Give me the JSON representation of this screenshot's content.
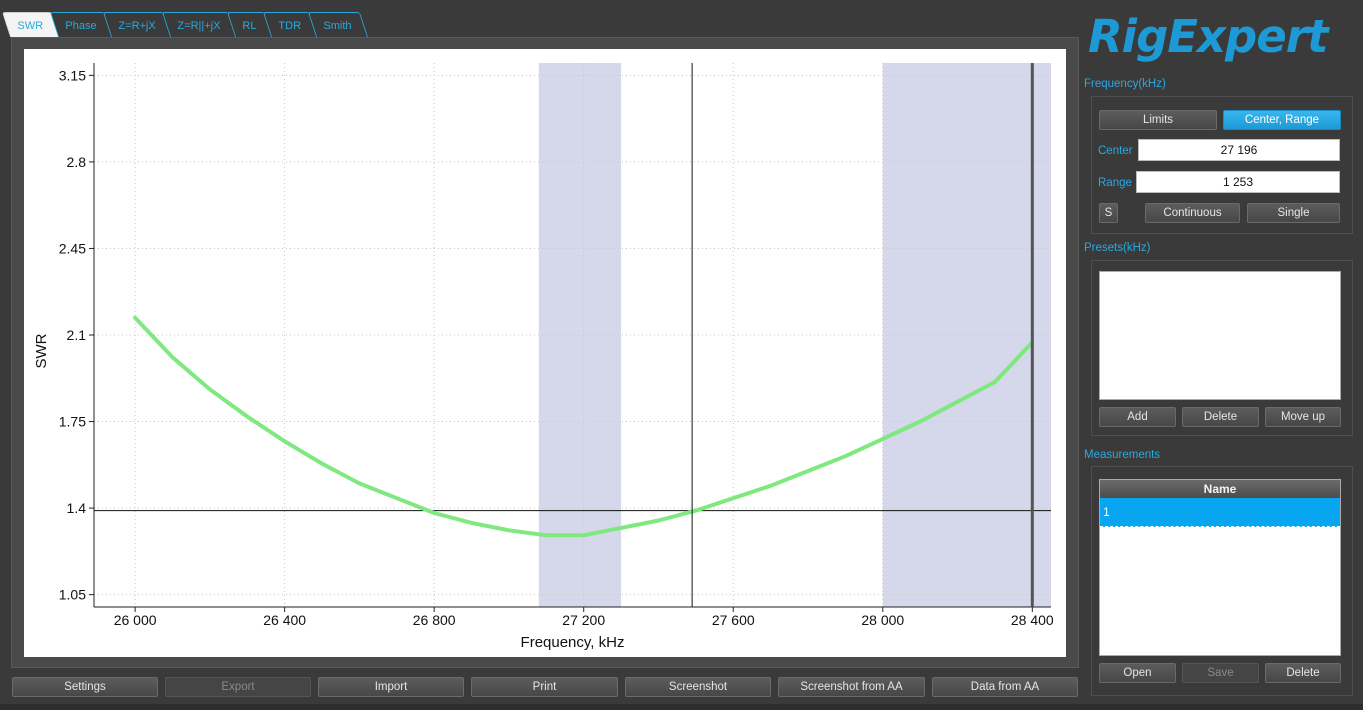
{
  "tabs": [
    "SWR",
    "Phase",
    "Z=R+jX",
    "Z=R||+jX",
    "RL",
    "TDR",
    "Smith"
  ],
  "active_tab": "SWR",
  "logo_text": "RigExpert",
  "frequency": {
    "title": "Frequency(kHz)",
    "limits_label": "Limits",
    "center_range_label": "Center, Range",
    "center_label": "Center",
    "center_value": "27 196",
    "range_label": "Range",
    "range_value": "1 253",
    "s_label": "S",
    "continuous_label": "Continuous",
    "single_label": "Single"
  },
  "presets": {
    "title": "Presets(kHz)",
    "add_label": "Add",
    "delete_label": "Delete",
    "move_up_label": "Move up"
  },
  "measurements": {
    "title": "Measurements",
    "column_name": "Name",
    "rows": [
      "1"
    ],
    "open_label": "Open",
    "save_label": "Save",
    "delete_label": "Delete"
  },
  "bottom_buttons": {
    "settings": "Settings",
    "export": "Export",
    "import": "Import",
    "print": "Print",
    "screenshot": "Screenshot",
    "screenshot_from_aa": "Screenshot from AA",
    "data_from_aa": "Data from AA"
  },
  "colors": {
    "accent": "#29a9e0",
    "curve": "#7fe87f",
    "band": "#d5d7ea",
    "selection": "#08a6f0"
  },
  "chart_data": {
    "type": "line",
    "xlabel": "Frequency, kHz",
    "ylabel": "SWR",
    "xlim": [
      25890,
      28450
    ],
    "ylim": [
      1.0,
      3.2
    ],
    "x_ticks": [
      26000,
      26400,
      26800,
      27200,
      27600,
      28000,
      28400
    ],
    "x_tick_labels": [
      "26 000",
      "26 400",
      "26 800",
      "27 200",
      "27 600",
      "28 000",
      "28 400"
    ],
    "y_ticks": [
      1.05,
      1.4,
      1.75,
      2.1,
      2.45,
      2.8,
      3.15
    ],
    "y_tick_labels": [
      "1.05",
      "1.4",
      "1.75",
      "2.1",
      "2.45",
      "2.8",
      "3.15"
    ],
    "grid": true,
    "bands": [
      [
        27080,
        27300
      ],
      [
        28000,
        28450
      ]
    ],
    "markers": [
      {
        "x": 27490
      },
      {
        "x": 28400
      }
    ],
    "reference_line_y": 1.39,
    "series": [
      {
        "x": [
          26000,
          26100,
          26200,
          26300,
          26400,
          26500,
          26600,
          26700,
          26800,
          26900,
          27000,
          27100,
          27150,
          27200,
          27300,
          27400,
          27500,
          27600,
          27700,
          27800,
          27900,
          28000,
          28100,
          28200,
          28300,
          28400
        ],
        "values": [
          2.17,
          2.01,
          1.88,
          1.77,
          1.67,
          1.58,
          1.5,
          1.44,
          1.38,
          1.34,
          1.31,
          1.29,
          1.29,
          1.29,
          1.32,
          1.35,
          1.39,
          1.44,
          1.49,
          1.55,
          1.61,
          1.68,
          1.75,
          1.83,
          1.91,
          2.07
        ]
      }
    ]
  }
}
